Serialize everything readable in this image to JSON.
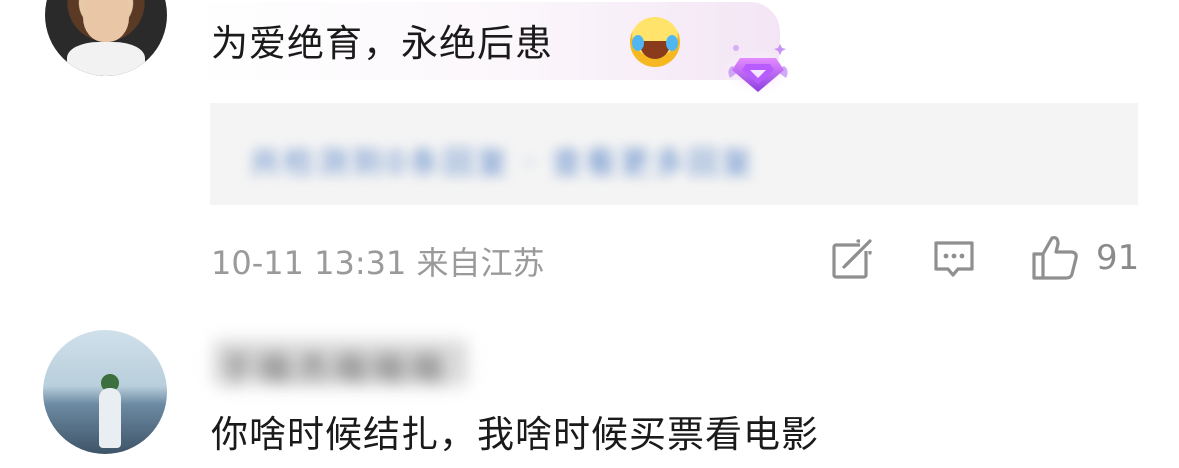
{
  "comments": [
    {
      "text": "为爱绝育，永绝后患",
      "emoji": "laughing-crying-emoji",
      "badge": "purple-gem-badge",
      "reply_preview": "共检测到0条回复 · 查看更多回复",
      "meta": "10-11 13:31 来自江苏",
      "likes": "91"
    },
    {
      "username_blurred": "于晓杰晓晓晓",
      "text": "你啥时候结扎，我啥时候买票看电影"
    }
  ],
  "colors": {
    "meta_gray": "#9a9a9a",
    "bubble_accent": "#f3e5f5",
    "reply_link": "#5a86c8"
  }
}
